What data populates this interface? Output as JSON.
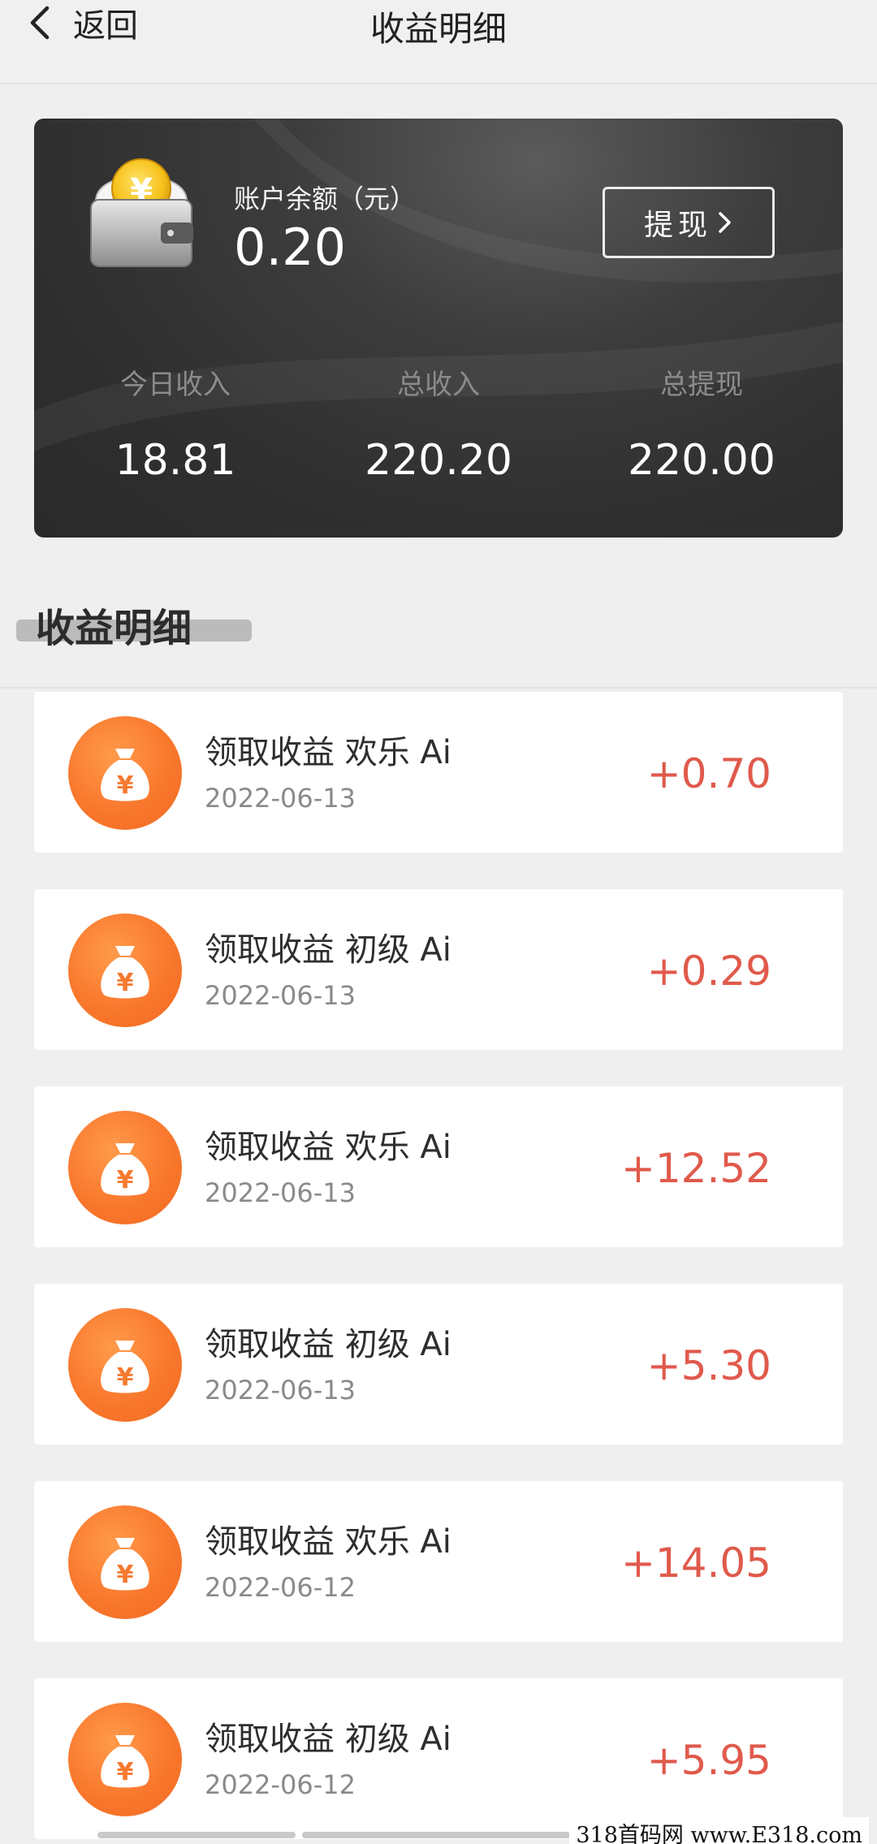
{
  "header": {
    "back_label": "返回",
    "title": "收益明细"
  },
  "balance": {
    "label": "账户余额（元）",
    "value": "0.20",
    "withdraw_label": "提现",
    "stats": [
      {
        "label": "今日收入",
        "value": "18.81"
      },
      {
        "label": "总收入",
        "value": "220.20"
      },
      {
        "label": "总提现",
        "value": "220.00"
      }
    ]
  },
  "section": {
    "title": "收益明细"
  },
  "records": [
    {
      "title": "领取收益 欢乐 Ai",
      "date": "2022-06-13",
      "amount": "+0.70"
    },
    {
      "title": "领取收益 初级 Ai",
      "date": "2022-06-13",
      "amount": "+0.29"
    },
    {
      "title": "领取收益 欢乐 Ai",
      "date": "2022-06-13",
      "amount": "+12.52"
    },
    {
      "title": "领取收益 初级 Ai",
      "date": "2022-06-13",
      "amount": "+5.30"
    },
    {
      "title": "领取收益 欢乐 Ai",
      "date": "2022-06-12",
      "amount": "+14.05"
    },
    {
      "title": "领取收益 初级 Ai",
      "date": "2022-06-12",
      "amount": "+5.95"
    }
  ],
  "watermark": "318首码网 www.E318.com",
  "colors": {
    "amount": "#e05a4c",
    "icon_orange": "#f9782d",
    "card_dark": "#2f2f2f"
  },
  "icons": {
    "back": "chevron-left-icon",
    "withdraw_arrow": "chevron-right-icon",
    "wallet": "wallet-icon",
    "record": "money-bag-icon"
  }
}
